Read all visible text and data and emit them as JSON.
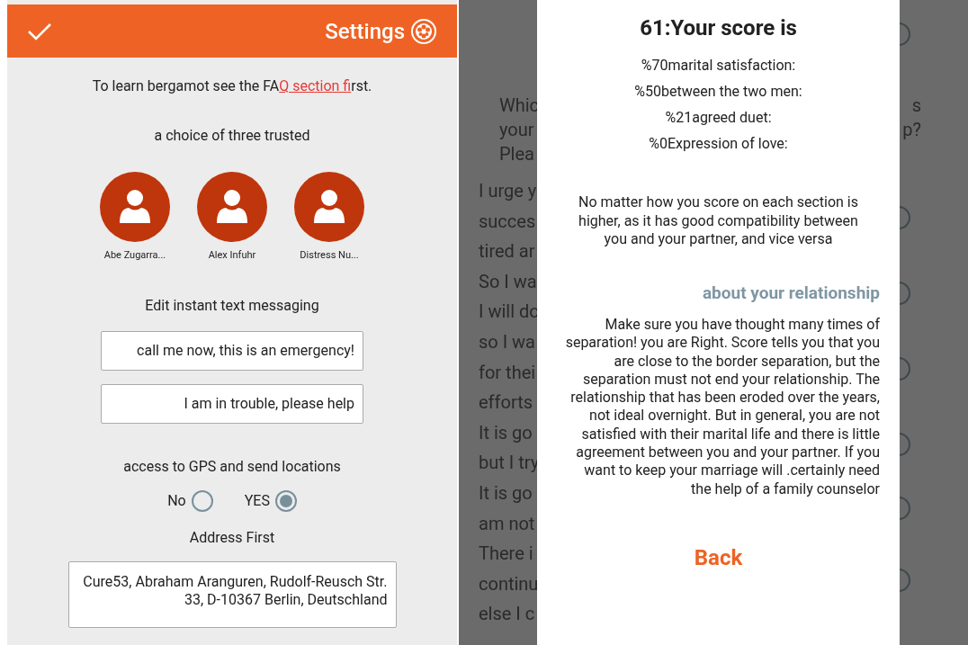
{
  "settings": {
    "title": "Settings",
    "faq": {
      "before": "To learn bergamot see the FA",
      "link": "Q section fi",
      "after": "rst."
    },
    "trusted_label": "a choice of three trusted",
    "contacts": [
      {
        "name": "Abe Zugarra..."
      },
      {
        "name": "Alex Infuhr"
      },
      {
        "name": "Distress Nu..."
      }
    ],
    "messages_label": "Edit instant text messaging",
    "messages": [
      {
        "value": "call me now, this is an emergency!"
      },
      {
        "value": "I am in trouble, please help"
      }
    ],
    "gps_label": "access to GPS and send locations",
    "gps_options": [
      {
        "label": "No",
        "selected": false
      },
      {
        "label": "YES",
        "selected": true
      }
    ],
    "address_label": "Address First",
    "address": "Cure53, Abraham Aranguren, Rudolf-Reusch Str. 33, D-10367 Berlin, Deutschland"
  },
  "background": {
    "question_lines": [
      {
        "left": "Whic",
        "right": "s"
      },
      {
        "left": "your",
        "right": "p?"
      },
      {
        "left": "Plea"
      }
    ],
    "lines": [
      "I urge y",
      "succes",
      "tired ar",
      "So I wa",
      "I will do",
      "so I wa",
      "for thei",
      "efforts",
      "It is go",
      "but I try",
      "It is go",
      "am not",
      "There i",
      "continu",
      "else I c"
    ]
  },
  "dialog": {
    "title": "61:Your score is",
    "scores": [
      "%70marital satisfaction:",
      "%50between the two men:",
      "%21agreed duet:",
      "%0Expression of love:"
    ],
    "note": "No matter how you score on each section is higher, as it has good compatibility between you and your partner, and vice versa",
    "section_title": "about your relationship",
    "body": "Make sure you have thought many times of separation! you are Right. Score tells you that you are close to the border separation, but the separation must not end your relationship. The relationship that has been eroded over the years, not ideal overnight. But in general, you are not satisfied with their marital life and there is little agreement between you and your partner. If you want to keep your marriage will .certainly need the help of a family counselor",
    "back": "Back"
  }
}
